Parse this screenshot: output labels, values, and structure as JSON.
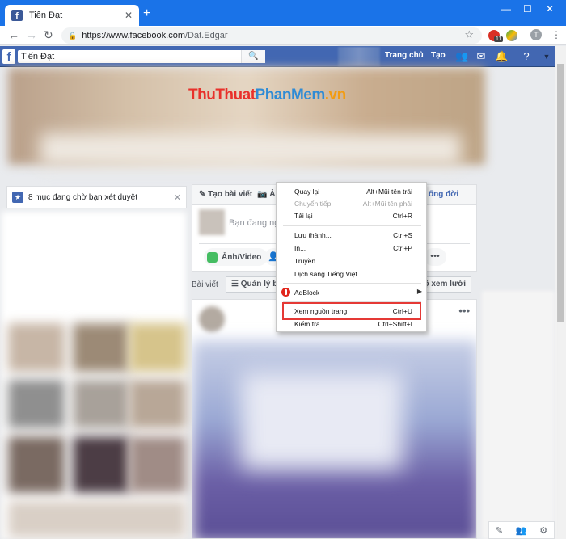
{
  "browser": {
    "tab_title": "Tiến Đạt",
    "new_tab": "+",
    "url_host": "https://www.facebook.com",
    "url_path": "/Dat.Edgar",
    "ext_badge": "11",
    "profile_letter": "T"
  },
  "facebook": {
    "logo": "f",
    "search_value": "Tiến Đạt",
    "nav_home": "Trang chủ",
    "nav_create": "Tạo"
  },
  "watermark": {
    "part1": "ThuThuat",
    "part2": "PhanMem",
    "part3": ".vn"
  },
  "sidebar": {
    "pending_text": "8 mục đang chờ bạn xét duyệt"
  },
  "composer": {
    "tab_create": "Tạo bài viết",
    "tab_photo": "Ả",
    "tab_right": "ống đời",
    "placeholder": "Bạn đang ngh",
    "photo_button": "Ảnh/Video",
    "more": "•••"
  },
  "posts_bar": {
    "label": "Bài viết",
    "manage": "Quản lý bà",
    "grid_view": "ế độ xem lưới"
  },
  "context_menu": {
    "items": [
      {
        "label": "Quay lại",
        "shortcut": "Alt+Mũi tên trái"
      },
      {
        "label": "Chuyển tiếp",
        "shortcut": "Alt+Mũi tên phải"
      },
      {
        "label": "Tải lại",
        "shortcut": "Ctrl+R"
      },
      {
        "label": "Lưu thành...",
        "shortcut": "Ctrl+S"
      },
      {
        "label": "In...",
        "shortcut": "Ctrl+P"
      },
      {
        "label": "Truyền...",
        "shortcut": ""
      },
      {
        "label": "Dịch sang Tiếng Việt",
        "shortcut": ""
      },
      {
        "label": "AdBlock",
        "shortcut": ""
      },
      {
        "label": "Xem nguồn trang",
        "shortcut": "Ctrl+U"
      },
      {
        "label": "Kiểm tra",
        "shortcut": "Ctrl+Shift+I"
      }
    ]
  },
  "colors": {
    "chrome_blue": "#1a73e8",
    "facebook_blue": "#4267b2",
    "highlight_red": "#e53935"
  }
}
